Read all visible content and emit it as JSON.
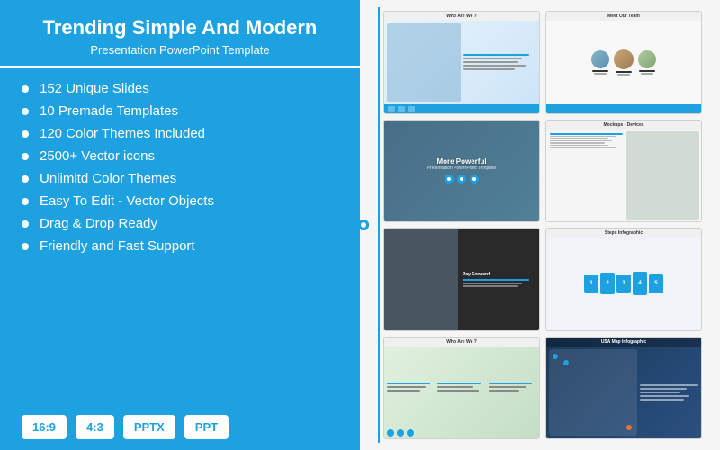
{
  "left": {
    "title": "Trending Simple And Modern",
    "subtitle": "Presentation PowerPoint Template",
    "features": [
      "152 Unique Slides",
      "10 Premade Templates",
      "120 Color Themes Included",
      "2500+ Vector icons",
      "Unlimitd Color Themes",
      "Easy To Edit - Vector Objects",
      "Drag & Drop Ready",
      "Friendly and Fast Support"
    ],
    "badges": [
      "16:9",
      "4:3",
      "PPTX",
      "PPT"
    ]
  },
  "right": {
    "slides": [
      {
        "id": "who-are-we",
        "label": "Who Are We ?"
      },
      {
        "id": "meet-team",
        "label": "Meet Our Team"
      },
      {
        "id": "more-powerful",
        "label": "More Powerful"
      },
      {
        "id": "mockups-devices",
        "label": "Mockups - Devices"
      },
      {
        "id": "steps-infographic",
        "label": "Steps Infographic"
      },
      {
        "id": "pay-forward",
        "label": "Pay Forward"
      },
      {
        "id": "who-are-we-2",
        "label": "Who Are We ?"
      },
      {
        "id": "usa-map",
        "label": "USA Map Infographic"
      }
    ]
  },
  "colors": {
    "primary": "#1da1e0",
    "white": "#ffffff",
    "bg": "#f5f5f5"
  }
}
